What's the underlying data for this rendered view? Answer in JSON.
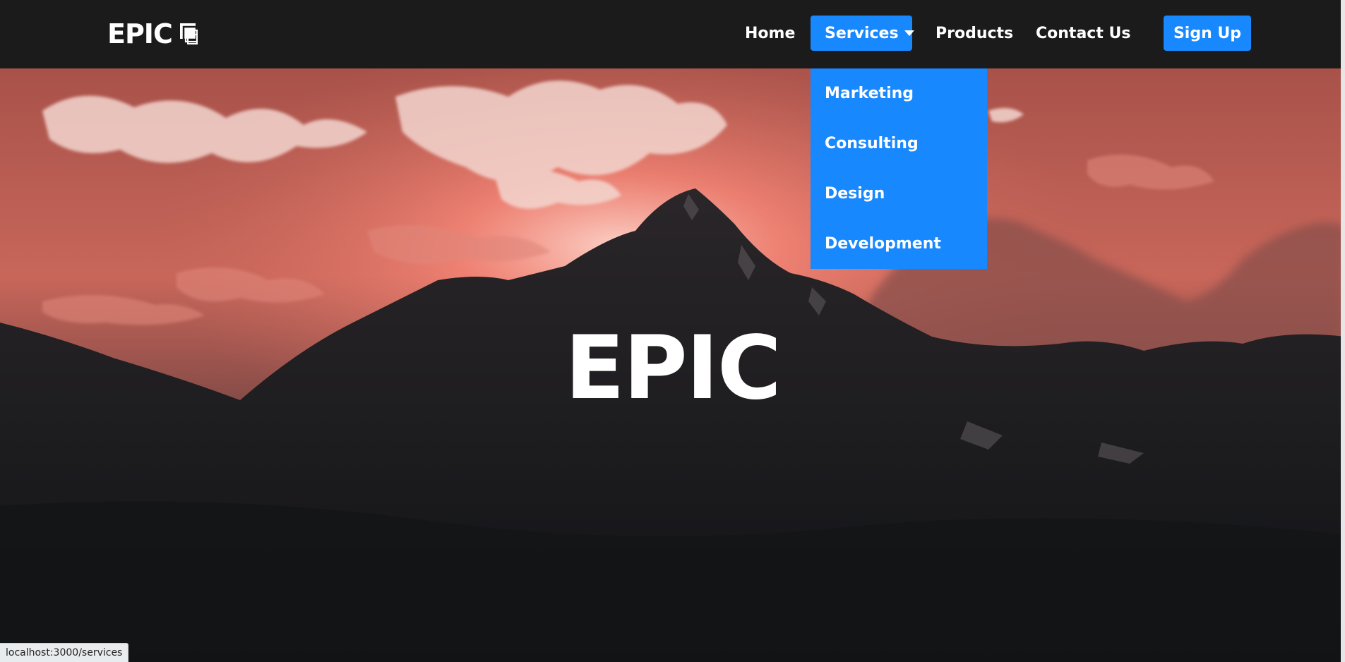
{
  "nav": {
    "logo_text": "EPIC",
    "logo_icon": "layered-squares-icon",
    "items": [
      {
        "label": "Home"
      },
      {
        "label": "Services",
        "active": true,
        "has_dropdown": true
      },
      {
        "label": "Products"
      },
      {
        "label": "Contact Us"
      }
    ],
    "signup_label": "Sign Up"
  },
  "dropdown": {
    "items": [
      {
        "label": "Marketing"
      },
      {
        "label": "Consulting"
      },
      {
        "label": "Design"
      },
      {
        "label": "Development"
      }
    ]
  },
  "hero": {
    "title": "EPIC"
  },
  "status_bar": {
    "url": "localhost:3000/services"
  },
  "colors": {
    "navbar_bg": "#1b1b1b",
    "accent": "#1888ff",
    "text": "#ffffff"
  }
}
